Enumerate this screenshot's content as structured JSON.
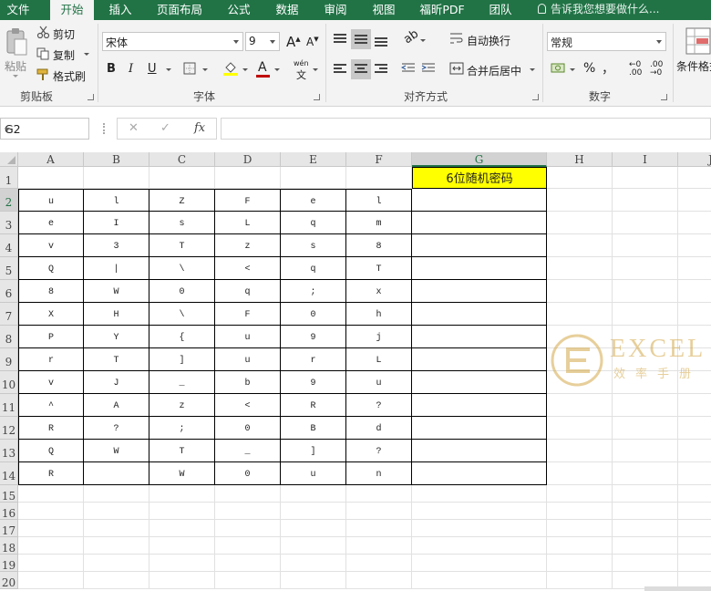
{
  "tabs": [
    {
      "label": "文件",
      "active": false
    },
    {
      "label": "开始",
      "active": true
    },
    {
      "label": "插入",
      "active": false
    },
    {
      "label": "页面布局",
      "active": false
    },
    {
      "label": "公式",
      "active": false
    },
    {
      "label": "数据",
      "active": false
    },
    {
      "label": "审阅",
      "active": false
    },
    {
      "label": "视图",
      "active": false
    },
    {
      "label": "福昕PDF",
      "active": false
    },
    {
      "label": "团队",
      "active": false
    }
  ],
  "tell_me": "告诉我您想要做什么...",
  "clipboard": {
    "paste": "粘贴",
    "cut": "剪切",
    "copy": "复制",
    "format_painter": "格式刷",
    "group_label": "剪贴板"
  },
  "font": {
    "family": "宋体",
    "size": "9",
    "bold": "B",
    "italic": "I",
    "underline": "U",
    "font_color_letter": "A",
    "phonetic_top": "wén",
    "phonetic_bottom": "文",
    "highlight_color": "#ffff00",
    "font_color": "#c00000",
    "group_label": "字体"
  },
  "alignment": {
    "wrap_text": "自动换行",
    "merge_center": "合并后居中",
    "group_label": "对齐方式"
  },
  "number": {
    "format": "常规",
    "percent": "%",
    "comma": "，",
    "group_label": "数字"
  },
  "styles": {
    "conditional": "条件格式"
  },
  "formula_bar": {
    "name_box": "G2",
    "cancel": "✕",
    "enter": "✓",
    "fx": "fx",
    "content": ""
  },
  "sheet": {
    "columns": [
      "A",
      "B",
      "C",
      "D",
      "E",
      "F",
      "G",
      "H",
      "I",
      "J"
    ],
    "selected_column": "G",
    "selected_row": "2",
    "title_cell": "6位随机密码",
    "title_highlight": "#ffff00",
    "rows": [
      {
        "n": "2",
        "cells": [
          "u",
          "l",
          "Z",
          "F",
          "e",
          "l"
        ]
      },
      {
        "n": "3",
        "cells": [
          "e",
          "I",
          "s",
          "L",
          "q",
          "m"
        ]
      },
      {
        "n": "4",
        "cells": [
          "v",
          "3",
          "T",
          "z",
          "s",
          "8"
        ]
      },
      {
        "n": "5",
        "cells": [
          "Q",
          "|",
          "\\",
          "<",
          "q",
          "T"
        ]
      },
      {
        "n": "6",
        "cells": [
          "8",
          "W",
          "0",
          "q",
          ";",
          "x"
        ]
      },
      {
        "n": "7",
        "cells": [
          "X",
          "H",
          "\\",
          "F",
          "0",
          "h"
        ]
      },
      {
        "n": "8",
        "cells": [
          "P",
          "Y",
          "{",
          "u",
          "9",
          "j"
        ]
      },
      {
        "n": "9",
        "cells": [
          "r",
          "T",
          "]",
          "u",
          "r",
          "L"
        ]
      },
      {
        "n": "10",
        "cells": [
          "v",
          "J",
          "_",
          "b",
          "9",
          "u"
        ]
      },
      {
        "n": "11",
        "cells": [
          "^",
          "A",
          "z",
          "<",
          "R",
          "?"
        ]
      },
      {
        "n": "12",
        "cells": [
          "R",
          "?",
          ";",
          "0",
          "B",
          "d"
        ]
      },
      {
        "n": "13",
        "cells": [
          "Q",
          "W",
          "T",
          "_",
          "]",
          "?"
        ]
      },
      {
        "n": "14",
        "cells": [
          "R",
          "",
          "W",
          "0",
          "u",
          "n"
        ]
      }
    ],
    "row_numbers": [
      "1",
      "2",
      "3",
      "4",
      "5",
      "6",
      "7",
      "8",
      "9",
      "10",
      "11",
      "12",
      "13",
      "14",
      "15",
      "16",
      "17",
      "18",
      "19",
      "20"
    ]
  },
  "watermark": {
    "word": "EXCEL",
    "sub": "效率手册",
    "color": "#d4a94a"
  }
}
